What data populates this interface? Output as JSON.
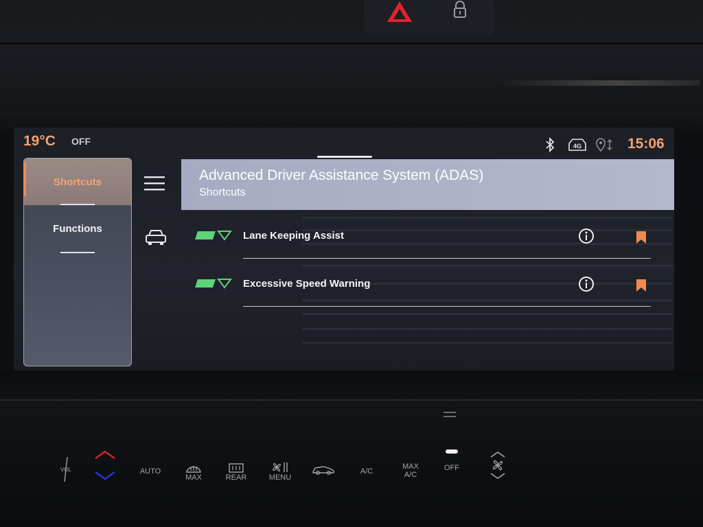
{
  "status_bar": {
    "temperature": "19°C",
    "climate_state": "OFF",
    "time": "15:06",
    "icons": [
      "bluetooth-icon",
      "4g-icon",
      "location-icon"
    ],
    "network_label": "4G"
  },
  "sidebar": {
    "tabs": [
      {
        "label": "Shortcuts",
        "active": true
      },
      {
        "label": "Functions",
        "active": false
      }
    ]
  },
  "header": {
    "title": "Advanced Driver Assistance System (ADAS)",
    "subtitle": "Shortcuts"
  },
  "list": {
    "items": [
      {
        "label": "Lane Keeping Assist",
        "info_icon": "info-icon",
        "bookmark_icon": "bookmark-icon"
      },
      {
        "label": "Excessive Speed Warning",
        "info_icon": "info-icon",
        "bookmark_icon": "bookmark-icon"
      }
    ]
  },
  "climate_controls": {
    "vol": "VOL",
    "auto": "AUTO",
    "max_front": "MAX",
    "rear": "REAR",
    "menu": "MENU",
    "ac": "A/C",
    "max_ac_line1": "MAX",
    "max_ac_line2": "A/C",
    "off": "OFF"
  },
  "colors": {
    "accent_orange": "#f3a271",
    "status_green": "#5fd37a",
    "header_bg": "#a7abc2",
    "bookmark": "#f08a4e"
  }
}
